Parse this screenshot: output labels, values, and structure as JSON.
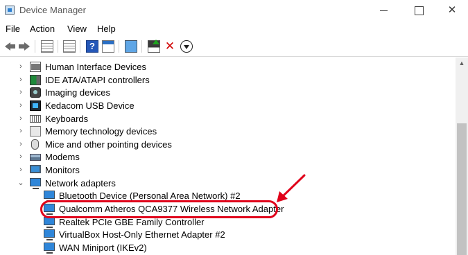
{
  "window": {
    "title": "Device Manager",
    "controls": {
      "minimize_icon": "minimize-icon",
      "maximize_icon": "maximize-icon",
      "close_icon": "close-icon",
      "close_glyph": "✕"
    }
  },
  "menu": {
    "items": [
      "File",
      "Action",
      "View",
      "Help"
    ]
  },
  "toolbar": {
    "icons": [
      "back-arrow-icon",
      "forward-arrow-icon",
      "show-hide-console-tree-icon",
      "properties-icon",
      "help-icon",
      "action-pane-icon",
      "scan-hardware-icon",
      "update-driver-icon",
      "uninstall-device-icon",
      "disable-device-icon"
    ],
    "help_glyph": "?",
    "uninstall_glyph": "✕"
  },
  "tree": {
    "collapsed_chevron": "›",
    "expanded_chevron": "⌄",
    "categories": [
      {
        "label": "Human Interface Devices",
        "icon": "hid-icon",
        "expanded": false
      },
      {
        "label": "IDE ATA/ATAPI controllers",
        "icon": "ide-controller-icon",
        "expanded": false
      },
      {
        "label": "Imaging devices",
        "icon": "camera-icon",
        "expanded": false
      },
      {
        "label": "Kedacom USB Device",
        "icon": "usb-device-icon",
        "expanded": false
      },
      {
        "label": "Keyboards",
        "icon": "keyboard-icon",
        "expanded": false
      },
      {
        "label": "Memory technology devices",
        "icon": "memory-device-icon",
        "expanded": false
      },
      {
        "label": "Mice and other pointing devices",
        "icon": "mouse-icon",
        "expanded": false
      },
      {
        "label": "Modems",
        "icon": "modem-icon",
        "expanded": false
      },
      {
        "label": "Monitors",
        "icon": "monitor-icon",
        "expanded": false
      },
      {
        "label": "Network adapters",
        "icon": "network-adapter-icon",
        "expanded": true
      }
    ],
    "network_adapters": [
      {
        "label": "Bluetooth Device (Personal Area Network) #2",
        "icon": "network-adapter-icon"
      },
      {
        "label": "Qualcomm Atheros QCA9377 Wireless Network Adapter",
        "icon": "network-adapter-icon",
        "highlighted": true
      },
      {
        "label": "Realtek PCIe GBE Family Controller",
        "icon": "network-adapter-icon"
      },
      {
        "label": "VirtualBox Host-Only Ethernet Adapter #2",
        "icon": "network-adapter-icon"
      },
      {
        "label": "WAN Miniport (IKEv2)",
        "icon": "network-adapter-icon"
      }
    ]
  },
  "scrollbar": {
    "up_glyph": "▲",
    "up_icon": "scroll-up-icon"
  },
  "annotation": {
    "color": "#e0001a",
    "shape": "rounded-rectangle-and-arrow"
  },
  "colors": {
    "highlight": "#e0001a",
    "network_icon": "#2f86d9"
  }
}
